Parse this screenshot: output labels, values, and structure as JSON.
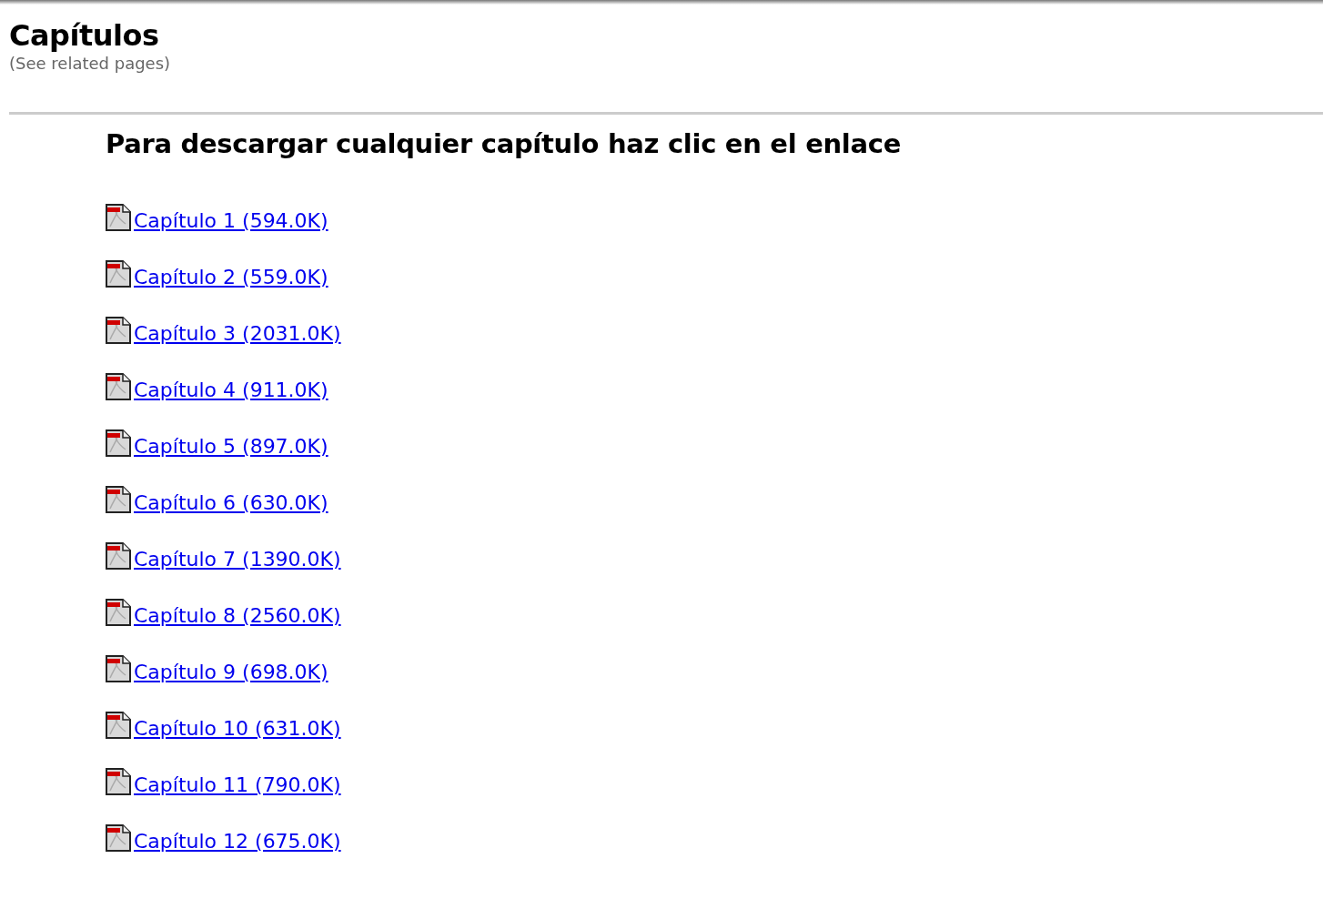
{
  "title": "Capítulos",
  "subtitle": "(See related pages)",
  "heading": "Para descargar cualquier capítulo haz clic en el enlace",
  "chapters": [
    {
      "label": "Capítulo 1 (594.0K)"
    },
    {
      "label": "Capítulo 2 (559.0K)"
    },
    {
      "label": "Capítulo 3 (2031.0K)"
    },
    {
      "label": "Capítulo 4 (911.0K)"
    },
    {
      "label": "Capítulo 5 (897.0K)"
    },
    {
      "label": "Capítulo 6 (630.0K)"
    },
    {
      "label": "Capítulo 7 (1390.0K)"
    },
    {
      "label": "Capítulo 8 (2560.0K)"
    },
    {
      "label": "Capítulo 9 (698.0K)"
    },
    {
      "label": "Capítulo 10 (631.0K)"
    },
    {
      "label": "Capítulo 11 (790.0K)"
    },
    {
      "label": "Capítulo 12 (675.0K)"
    }
  ]
}
